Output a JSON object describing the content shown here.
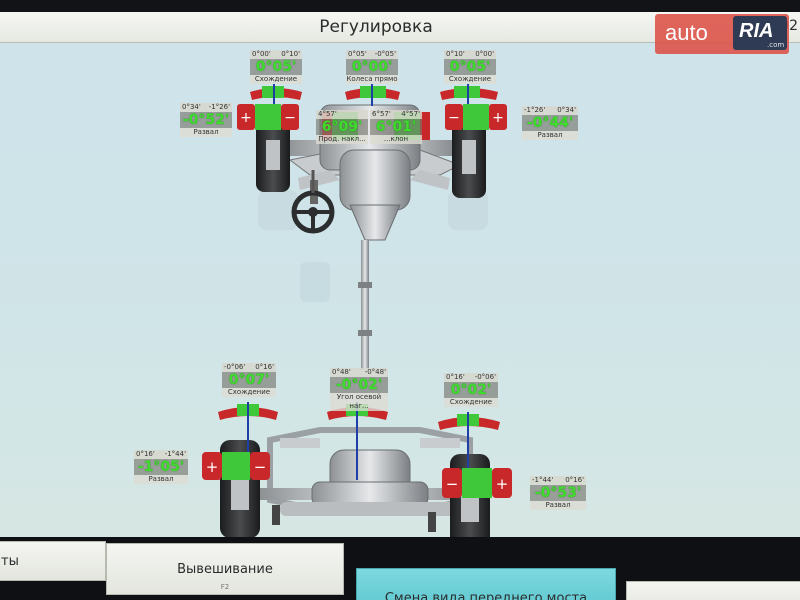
{
  "window": {
    "title": "Регулировка",
    "right_code": "02"
  },
  "watermark": {
    "auto": "auto",
    "ria": "RIA",
    "dotcom": ".com"
  },
  "colors": {
    "value_green": "#3edc2c",
    "accent_cyan": "#63c9d0",
    "red_zone": "#c8282a",
    "green_zone": "#3ec83a"
  },
  "front": {
    "left_toe": {
      "min": "0°00'",
      "max": "0°10'",
      "value": "0°05'",
      "label": "Схождение"
    },
    "total_toe": {
      "min": "0°05'",
      "max": "-0°05'",
      "value": "0°00'",
      "label": "Колеса прямо"
    },
    "right_toe": {
      "min": "0°10'",
      "max": "0°00'",
      "value": "0°05'",
      "label": "Схождение"
    },
    "left_camber": {
      "min": "0°34'",
      "max": "-1°26'",
      "value": "-0°52'",
      "label": "Развал"
    },
    "right_camber": {
      "min": "-1°26'",
      "max": "0°34'",
      "value": "-0°44'",
      "label": "Развал"
    },
    "left_caster": {
      "min": "4°57'",
      "max": "",
      "value": "6°09'",
      "label": "Прод. накл..."
    },
    "right_caster": {
      "min": "6°57'",
      "max": "4°57'",
      "value": "6°01'",
      "label": "...клон"
    }
  },
  "rear": {
    "left_toe": {
      "min": "-0°06'",
      "max": "0°16'",
      "value": "0°07'",
      "label": "Схождение"
    },
    "thrust": {
      "min": "0°48'",
      "max": "-0°48'",
      "value": "-0°02'",
      "label": "Угол осевой наг..."
    },
    "right_toe": {
      "min": "0°16'",
      "max": "-0°06'",
      "value": "0°02'",
      "label": "Схождение"
    },
    "left_camber": {
      "min": "0°16'",
      "max": "-1°44'",
      "value": "-1°05'",
      "label": "Развал"
    },
    "right_camber": {
      "min": "-1°44'",
      "max": "0°16'",
      "value": "-0°53'",
      "label": "Развал"
    }
  },
  "bottom_buttons": [
    {
      "label": "ты",
      "sub": ""
    },
    {
      "label": "Вывешивание",
      "sub": "F2"
    },
    {
      "label": "Смена вида переднего моста",
      "sub": ""
    },
    {
      "label": "",
      "sub": ""
    }
  ]
}
